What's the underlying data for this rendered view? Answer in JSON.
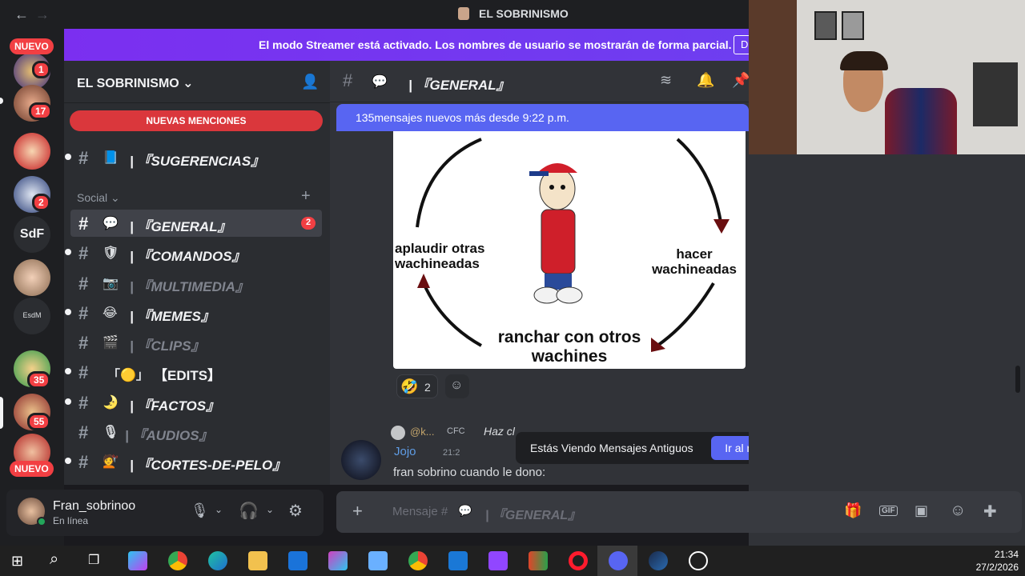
{
  "titlebar": {
    "title": "EL SOBRINISMO"
  },
  "banner": {
    "text": "El modo Streamer está activado. Los nombres de usuario se mostrarán de forma parcial.",
    "button": "D"
  },
  "rail": {
    "new_top": "NUEVO",
    "new_bottom": "NUEVO",
    "badges": [
      "1",
      "17",
      "2",
      "35",
      "55"
    ],
    "sdf": "SdF",
    "esdm": "EsdM"
  },
  "server": {
    "name": "EL SOBRINISMO"
  },
  "sidebar": {
    "mentions": "NUEVAS MENCIONES",
    "category": "Social",
    "channels": [
      {
        "emoji": "📘",
        "name": "| 『SUGERENCIAS』"
      },
      {
        "emoji": "💬",
        "name": "| 『GENERAL』",
        "badge": "2"
      },
      {
        "emoji": "🛡",
        "name": "| 『COMANDOS』"
      },
      {
        "emoji": "📷",
        "name": "| 『MULTIMEDIA』"
      },
      {
        "emoji": "😂",
        "name": "| 『MEMES』"
      },
      {
        "emoji": "🎬",
        "name": "| 『CLIPS』"
      },
      {
        "emoji": "「🟡」",
        "name": "【EDITS】"
      },
      {
        "emoji": "🌛",
        "name": "| 『FACTOS』"
      },
      {
        "emoji": "🎙",
        "name": "| 『AUDIOS』"
      },
      {
        "emoji": "💇",
        "name": "| 『CORTES-DE-PELO』"
      }
    ]
  },
  "user": {
    "name": "Fran_sobrinoo",
    "status": "En línea"
  },
  "chat": {
    "channel": "| 『GENERAL』",
    "new_messages": "135mensajes nuevos más desde 9:22 p.m.",
    "meme": {
      "left": "aplaudir otras wachineadas",
      "right": "hacer wachineadas",
      "bottom": "ranchar con otros wachines"
    },
    "reaction_count": "2",
    "reply_user": "@k...",
    "reply_tag": "CFC",
    "reply_text": "Haz cl",
    "author": "Jojo",
    "time": "21:2",
    "message": "fran sobrino cuando le dono:",
    "older_label": "Estás Viendo Mensajes Antiguos",
    "jump_label": "Ir al mensaje actual",
    "input_placeholder": "Mensaje #",
    "input_channel": "| 『GENERAL』"
  },
  "taskbar": {
    "time": "21:34",
    "date": "27/2/2026"
  }
}
